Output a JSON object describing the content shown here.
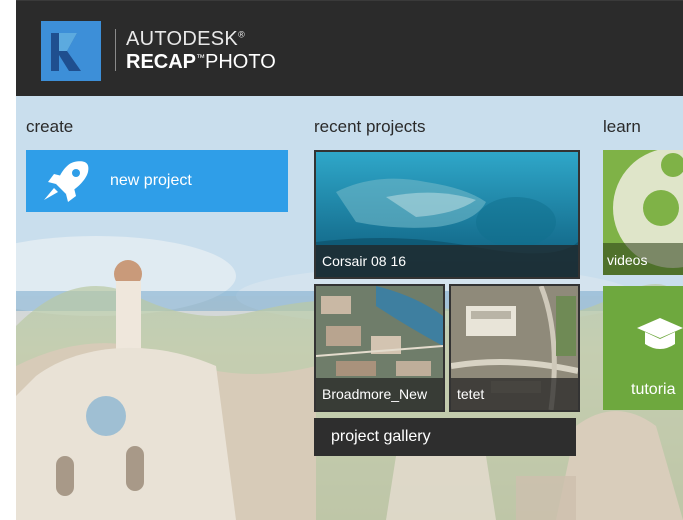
{
  "header": {
    "brand_line1": "AUTODESK",
    "brand_line1_mark": "®",
    "brand_line2_bold": "RECAP",
    "brand_line2_mark": "™",
    "brand_line2_light": "PHOTO"
  },
  "sections": {
    "create": "create",
    "recent": "recent projects",
    "learn": "learn"
  },
  "create": {
    "new_project_label": "new project",
    "icon": "rocket-icon"
  },
  "recent": {
    "projects": [
      {
        "name": "Corsair 08 16"
      },
      {
        "name": "Broadmore_New"
      },
      {
        "name": "tetet"
      }
    ],
    "gallery_label": "project gallery"
  },
  "learn": {
    "videos_label": "videos",
    "tutorials_label": "tutoria",
    "tutorials_icon": "graduation-cap-icon"
  },
  "colors": {
    "header_bg": "#2b2b2b",
    "accent_blue": "#2f9ee8",
    "learn_green": "#7fb247",
    "gallery_bg": "#2e2e2e"
  }
}
